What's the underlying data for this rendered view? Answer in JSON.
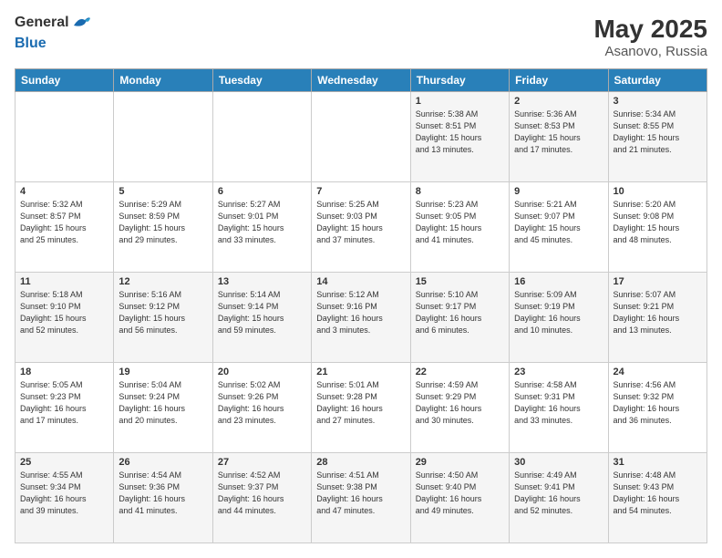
{
  "header": {
    "logo_general": "General",
    "logo_blue": "Blue",
    "month_year": "May 2025",
    "location": "Asanovo, Russia"
  },
  "days_of_week": [
    "Sunday",
    "Monday",
    "Tuesday",
    "Wednesday",
    "Thursday",
    "Friday",
    "Saturday"
  ],
  "weeks": [
    [
      {
        "day": "",
        "info": ""
      },
      {
        "day": "",
        "info": ""
      },
      {
        "day": "",
        "info": ""
      },
      {
        "day": "",
        "info": ""
      },
      {
        "day": "1",
        "info": "Sunrise: 5:38 AM\nSunset: 8:51 PM\nDaylight: 15 hours\nand 13 minutes."
      },
      {
        "day": "2",
        "info": "Sunrise: 5:36 AM\nSunset: 8:53 PM\nDaylight: 15 hours\nand 17 minutes."
      },
      {
        "day": "3",
        "info": "Sunrise: 5:34 AM\nSunset: 8:55 PM\nDaylight: 15 hours\nand 21 minutes."
      }
    ],
    [
      {
        "day": "4",
        "info": "Sunrise: 5:32 AM\nSunset: 8:57 PM\nDaylight: 15 hours\nand 25 minutes."
      },
      {
        "day": "5",
        "info": "Sunrise: 5:29 AM\nSunset: 8:59 PM\nDaylight: 15 hours\nand 29 minutes."
      },
      {
        "day": "6",
        "info": "Sunrise: 5:27 AM\nSunset: 9:01 PM\nDaylight: 15 hours\nand 33 minutes."
      },
      {
        "day": "7",
        "info": "Sunrise: 5:25 AM\nSunset: 9:03 PM\nDaylight: 15 hours\nand 37 minutes."
      },
      {
        "day": "8",
        "info": "Sunrise: 5:23 AM\nSunset: 9:05 PM\nDaylight: 15 hours\nand 41 minutes."
      },
      {
        "day": "9",
        "info": "Sunrise: 5:21 AM\nSunset: 9:07 PM\nDaylight: 15 hours\nand 45 minutes."
      },
      {
        "day": "10",
        "info": "Sunrise: 5:20 AM\nSunset: 9:08 PM\nDaylight: 15 hours\nand 48 minutes."
      }
    ],
    [
      {
        "day": "11",
        "info": "Sunrise: 5:18 AM\nSunset: 9:10 PM\nDaylight: 15 hours\nand 52 minutes."
      },
      {
        "day": "12",
        "info": "Sunrise: 5:16 AM\nSunset: 9:12 PM\nDaylight: 15 hours\nand 56 minutes."
      },
      {
        "day": "13",
        "info": "Sunrise: 5:14 AM\nSunset: 9:14 PM\nDaylight: 15 hours\nand 59 minutes."
      },
      {
        "day": "14",
        "info": "Sunrise: 5:12 AM\nSunset: 9:16 PM\nDaylight: 16 hours\nand 3 minutes."
      },
      {
        "day": "15",
        "info": "Sunrise: 5:10 AM\nSunset: 9:17 PM\nDaylight: 16 hours\nand 6 minutes."
      },
      {
        "day": "16",
        "info": "Sunrise: 5:09 AM\nSunset: 9:19 PM\nDaylight: 16 hours\nand 10 minutes."
      },
      {
        "day": "17",
        "info": "Sunrise: 5:07 AM\nSunset: 9:21 PM\nDaylight: 16 hours\nand 13 minutes."
      }
    ],
    [
      {
        "day": "18",
        "info": "Sunrise: 5:05 AM\nSunset: 9:23 PM\nDaylight: 16 hours\nand 17 minutes."
      },
      {
        "day": "19",
        "info": "Sunrise: 5:04 AM\nSunset: 9:24 PM\nDaylight: 16 hours\nand 20 minutes."
      },
      {
        "day": "20",
        "info": "Sunrise: 5:02 AM\nSunset: 9:26 PM\nDaylight: 16 hours\nand 23 minutes."
      },
      {
        "day": "21",
        "info": "Sunrise: 5:01 AM\nSunset: 9:28 PM\nDaylight: 16 hours\nand 27 minutes."
      },
      {
        "day": "22",
        "info": "Sunrise: 4:59 AM\nSunset: 9:29 PM\nDaylight: 16 hours\nand 30 minutes."
      },
      {
        "day": "23",
        "info": "Sunrise: 4:58 AM\nSunset: 9:31 PM\nDaylight: 16 hours\nand 33 minutes."
      },
      {
        "day": "24",
        "info": "Sunrise: 4:56 AM\nSunset: 9:32 PM\nDaylight: 16 hours\nand 36 minutes."
      }
    ],
    [
      {
        "day": "25",
        "info": "Sunrise: 4:55 AM\nSunset: 9:34 PM\nDaylight: 16 hours\nand 39 minutes."
      },
      {
        "day": "26",
        "info": "Sunrise: 4:54 AM\nSunset: 9:36 PM\nDaylight: 16 hours\nand 41 minutes."
      },
      {
        "day": "27",
        "info": "Sunrise: 4:52 AM\nSunset: 9:37 PM\nDaylight: 16 hours\nand 44 minutes."
      },
      {
        "day": "28",
        "info": "Sunrise: 4:51 AM\nSunset: 9:38 PM\nDaylight: 16 hours\nand 47 minutes."
      },
      {
        "day": "29",
        "info": "Sunrise: 4:50 AM\nSunset: 9:40 PM\nDaylight: 16 hours\nand 49 minutes."
      },
      {
        "day": "30",
        "info": "Sunrise: 4:49 AM\nSunset: 9:41 PM\nDaylight: 16 hours\nand 52 minutes."
      },
      {
        "day": "31",
        "info": "Sunrise: 4:48 AM\nSunset: 9:43 PM\nDaylight: 16 hours\nand 54 minutes."
      }
    ]
  ]
}
